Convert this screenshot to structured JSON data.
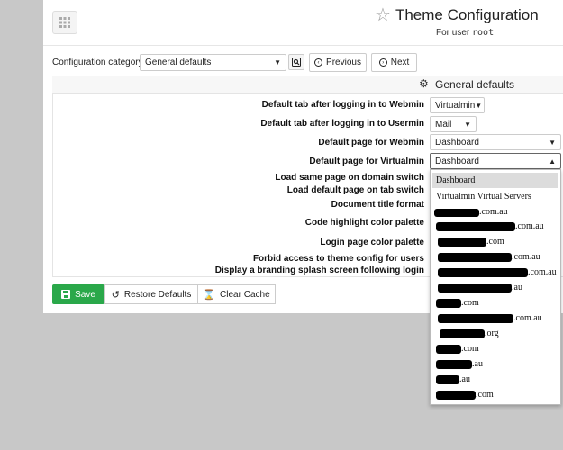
{
  "header": {
    "title": "Theme Configuration",
    "subtitle_prefix": "For user",
    "subtitle_user": "root"
  },
  "toolbar": {
    "category_label": "Configuration category:",
    "category_value": "General defaults",
    "previous_label": "Previous",
    "next_label": "Next"
  },
  "section": {
    "title": "General defaults",
    "rows": [
      {
        "label": "Default tab after logging in to Webmin",
        "value": "Virtualmin"
      },
      {
        "label": "Default tab after logging in to Usermin",
        "value": "Mail"
      },
      {
        "label": "Default page for Webmin",
        "value": "Dashboard"
      },
      {
        "label": "Default page for Virtualmin",
        "value": "Dashboard"
      },
      {
        "label": "Load same page on domain switch"
      },
      {
        "label": "Load default page on tab switch"
      },
      {
        "label": "Document title format"
      },
      {
        "label": "Code highlight color palette"
      },
      {
        "label": "Login page color palette"
      },
      {
        "label": "Forbid access to theme config for users"
      },
      {
        "label": "Display a branding splash screen following login"
      }
    ]
  },
  "actions": {
    "save": "Save",
    "restore": "Restore Defaults",
    "clear_cache": "Clear Cache"
  },
  "dropdown": {
    "options": [
      "Dashboard",
      "Virtualmin Virtual Servers",
      ".com.au",
      ".com.au",
      ".com",
      ".com.au",
      ".com.au",
      ".au",
      ".com",
      ".com.au",
      ".org",
      ".com",
      ".au",
      ".au",
      ".com"
    ]
  },
  "colors": {
    "save": "#2aa84a",
    "background": "#c8c8c8",
    "panel": "#ffffff"
  }
}
